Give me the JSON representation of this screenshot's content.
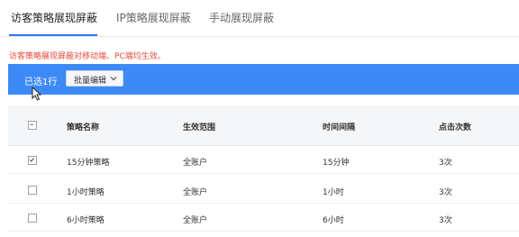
{
  "tabs": [
    {
      "label": "访客策略展现屏蔽",
      "active": true
    },
    {
      "label": "IP策略展现屏蔽",
      "active": false
    },
    {
      "label": "手动展现屏蔽",
      "active": false
    }
  ],
  "notice": "访客策略展现屏蔽对移动端、PC端均生效。",
  "toolbar": {
    "selected_count": "已选1行",
    "bulk_edit_label": "批量编辑"
  },
  "table": {
    "headers": [
      "策略名称",
      "生效范围",
      "时间间隔",
      "点击次数"
    ],
    "rows": [
      {
        "checked": true,
        "name": "15分钟策略",
        "scope": "全账户",
        "interval": "15分钟",
        "clicks": "3次"
      },
      {
        "checked": false,
        "name": "1小时策略",
        "scope": "全账户",
        "interval": "1小时",
        "clicks": "3次"
      },
      {
        "checked": false,
        "name": "6小时策略",
        "scope": "全账户",
        "interval": "6小时",
        "clicks": "3次"
      }
    ]
  },
  "colors": {
    "accent": "#3d8af7",
    "notice": "#e84b3c",
    "tab_underline": "#2d78f4"
  }
}
